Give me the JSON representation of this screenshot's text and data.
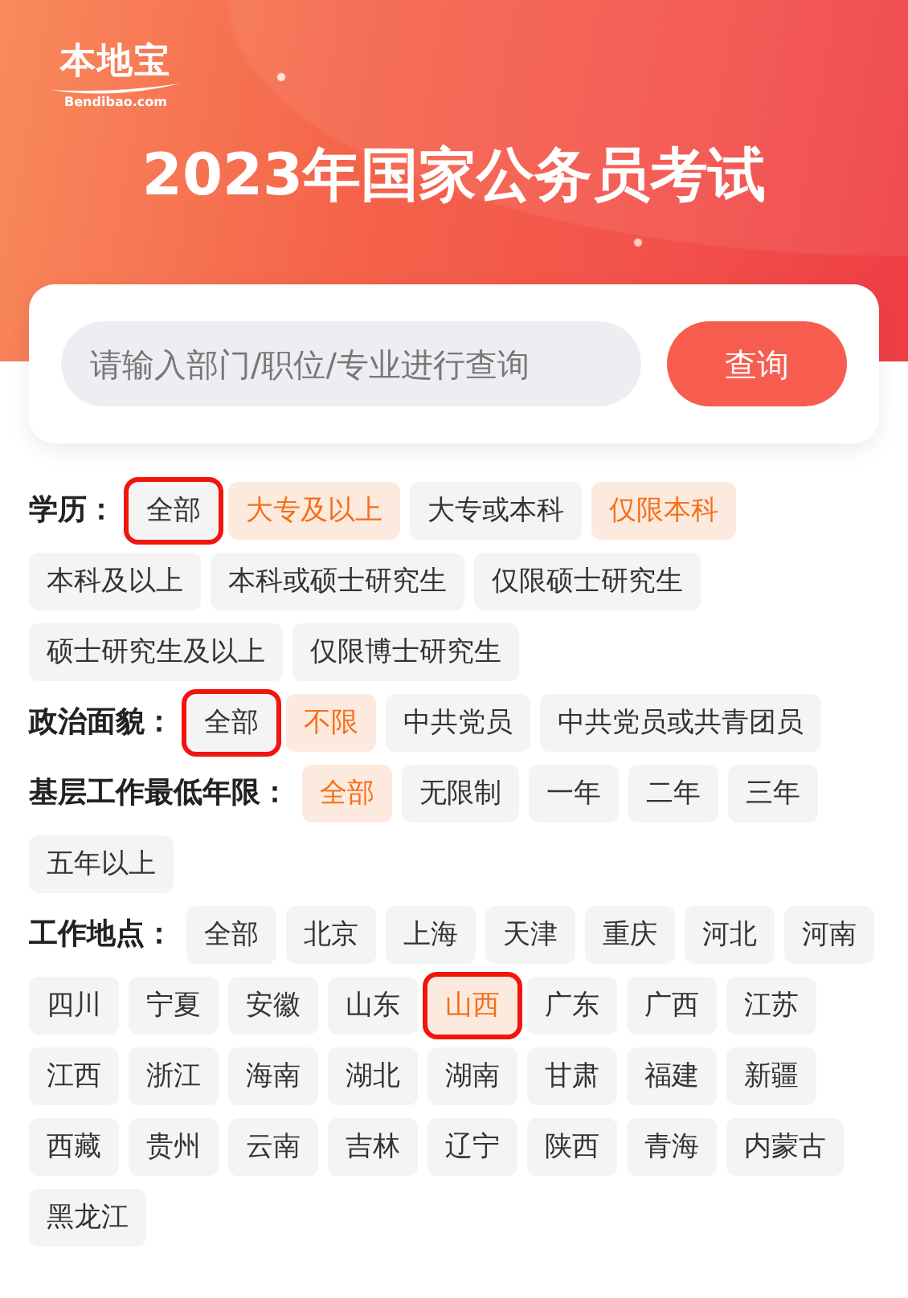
{
  "header": {
    "logo": {
      "name": "本地宝",
      "domain": "Bendibao.com"
    },
    "title": "2023年国家公务员考试"
  },
  "search": {
    "placeholder": "请输入部门/职位/专业进行查询",
    "button": "查询"
  },
  "filters": [
    {
      "label": "学历：",
      "options": [
        {
          "text": "全部",
          "selected": false,
          "outlined": true
        },
        {
          "text": "大专及以上",
          "selected": true,
          "outlined": false
        },
        {
          "text": "大专或本科",
          "selected": false,
          "outlined": false
        },
        {
          "text": "仅限本科",
          "selected": true,
          "outlined": false
        },
        {
          "text": "本科及以上",
          "selected": false,
          "outlined": false
        },
        {
          "text": "本科或硕士研究生",
          "selected": false,
          "outlined": false
        },
        {
          "text": "仅限硕士研究生",
          "selected": false,
          "outlined": false
        },
        {
          "text": "硕士研究生及以上",
          "selected": false,
          "outlined": false
        },
        {
          "text": "仅限博士研究生",
          "selected": false,
          "outlined": false
        }
      ]
    },
    {
      "label": "政治面貌：",
      "options": [
        {
          "text": "全部",
          "selected": false,
          "outlined": true
        },
        {
          "text": "不限",
          "selected": true,
          "outlined": false
        },
        {
          "text": "中共党员",
          "selected": false,
          "outlined": false
        },
        {
          "text": "中共党员或共青团员",
          "selected": false,
          "outlined": false
        }
      ]
    },
    {
      "label": "基层工作最低年限：",
      "options": [
        {
          "text": "全部",
          "selected": true,
          "outlined": false
        },
        {
          "text": "无限制",
          "selected": false,
          "outlined": false
        },
        {
          "text": "一年",
          "selected": false,
          "outlined": false
        },
        {
          "text": "二年",
          "selected": false,
          "outlined": false
        },
        {
          "text": "三年",
          "selected": false,
          "outlined": false
        },
        {
          "text": "五年以上",
          "selected": false,
          "outlined": false
        }
      ]
    },
    {
      "label": "工作地点：",
      "options": [
        {
          "text": "全部",
          "selected": false,
          "outlined": false
        },
        {
          "text": "北京",
          "selected": false,
          "outlined": false
        },
        {
          "text": "上海",
          "selected": false,
          "outlined": false
        },
        {
          "text": "天津",
          "selected": false,
          "outlined": false
        },
        {
          "text": "重庆",
          "selected": false,
          "outlined": false
        },
        {
          "text": "河北",
          "selected": false,
          "outlined": false
        },
        {
          "text": "河南",
          "selected": false,
          "outlined": false
        },
        {
          "text": "四川",
          "selected": false,
          "outlined": false
        },
        {
          "text": "宁夏",
          "selected": false,
          "outlined": false
        },
        {
          "text": "安徽",
          "selected": false,
          "outlined": false
        },
        {
          "text": "山东",
          "selected": false,
          "outlined": false
        },
        {
          "text": "山西",
          "selected": true,
          "outlined": true
        },
        {
          "text": "广东",
          "selected": false,
          "outlined": false
        },
        {
          "text": "广西",
          "selected": false,
          "outlined": false
        },
        {
          "text": "江苏",
          "selected": false,
          "outlined": false
        },
        {
          "text": "江西",
          "selected": false,
          "outlined": false
        },
        {
          "text": "浙江",
          "selected": false,
          "outlined": false
        },
        {
          "text": "海南",
          "selected": false,
          "outlined": false
        },
        {
          "text": "湖北",
          "selected": false,
          "outlined": false
        },
        {
          "text": "湖南",
          "selected": false,
          "outlined": false
        },
        {
          "text": "甘肃",
          "selected": false,
          "outlined": false
        },
        {
          "text": "福建",
          "selected": false,
          "outlined": false
        },
        {
          "text": "新疆",
          "selected": false,
          "outlined": false
        },
        {
          "text": "西藏",
          "selected": false,
          "outlined": false
        },
        {
          "text": "贵州",
          "selected": false,
          "outlined": false
        },
        {
          "text": "云南",
          "selected": false,
          "outlined": false
        },
        {
          "text": "吉林",
          "selected": false,
          "outlined": false
        },
        {
          "text": "辽宁",
          "selected": false,
          "outlined": false
        },
        {
          "text": "陕西",
          "selected": false,
          "outlined": false
        },
        {
          "text": "青海",
          "selected": false,
          "outlined": false
        },
        {
          "text": "内蒙古",
          "selected": false,
          "outlined": false
        },
        {
          "text": "黑龙江",
          "selected": false,
          "outlined": false
        }
      ]
    }
  ]
}
